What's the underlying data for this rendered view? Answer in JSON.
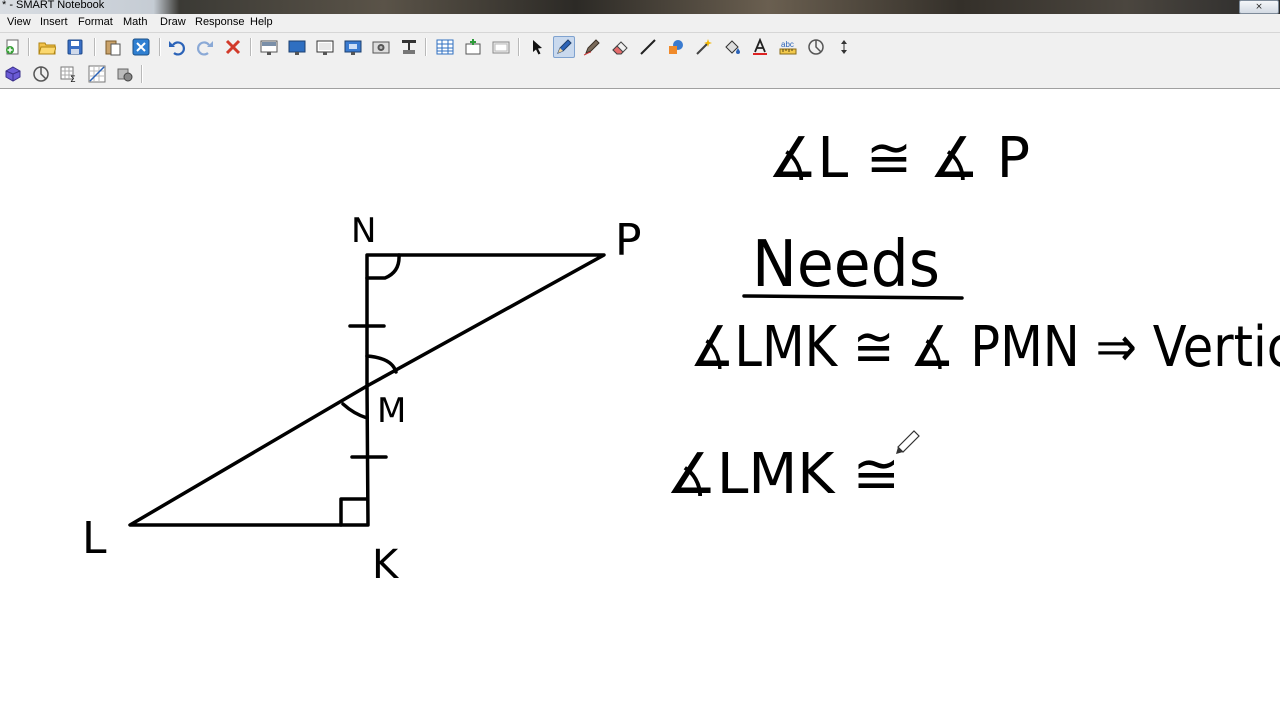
{
  "window": {
    "title": "* - SMART Notebook"
  },
  "menubar": {
    "items": [
      {
        "label": "View"
      },
      {
        "label": "Insert"
      },
      {
        "label": "Format"
      },
      {
        "label": "Math"
      },
      {
        "label": "Draw"
      },
      {
        "label": "Response"
      },
      {
        "label": "Help"
      }
    ]
  },
  "toolbar": {
    "row1_icons": [
      "new-page-icon",
      "open-folder-icon",
      "save-icon",
      "paste-icon",
      "delete-page-icon",
      "undo-icon",
      "redo-icon",
      "delete-icon",
      "screen-shade-icon",
      "full-screen-icon",
      "dual-screen-icon",
      "display-icon",
      "capture-icon",
      "document-camera-icon",
      "table-icon",
      "insert-icon",
      "properties-icon",
      "select-icon",
      "pen-icon",
      "creative-pen-icon",
      "eraser-icon",
      "line-icon",
      "shapes-icon",
      "magic-pen-icon",
      "fill-icon",
      "text-icon",
      "measurement-icon",
      "geometry-icon",
      "move-toolbar-icon"
    ],
    "row2_icons": [
      "shape-3d-icon",
      "protractor-icon",
      "math-equation-icon",
      "graph-icon",
      "settings-icon"
    ],
    "active_tool": "pen-icon",
    "accent_color": "#7fa2cf"
  },
  "canvas": {
    "background": "#ffffff",
    "ink_color": "#000000",
    "diagram_labels": {
      "n": "N",
      "p": "P",
      "m": "M",
      "l": "L",
      "k": "K"
    },
    "notes": {
      "line1": "∡L ≅ ∡ P",
      "heading": "Needs",
      "line2": "∡LMK ≅ ∡ PMN ⇒ Vertic",
      "line3": "∡LMK ≅"
    }
  }
}
